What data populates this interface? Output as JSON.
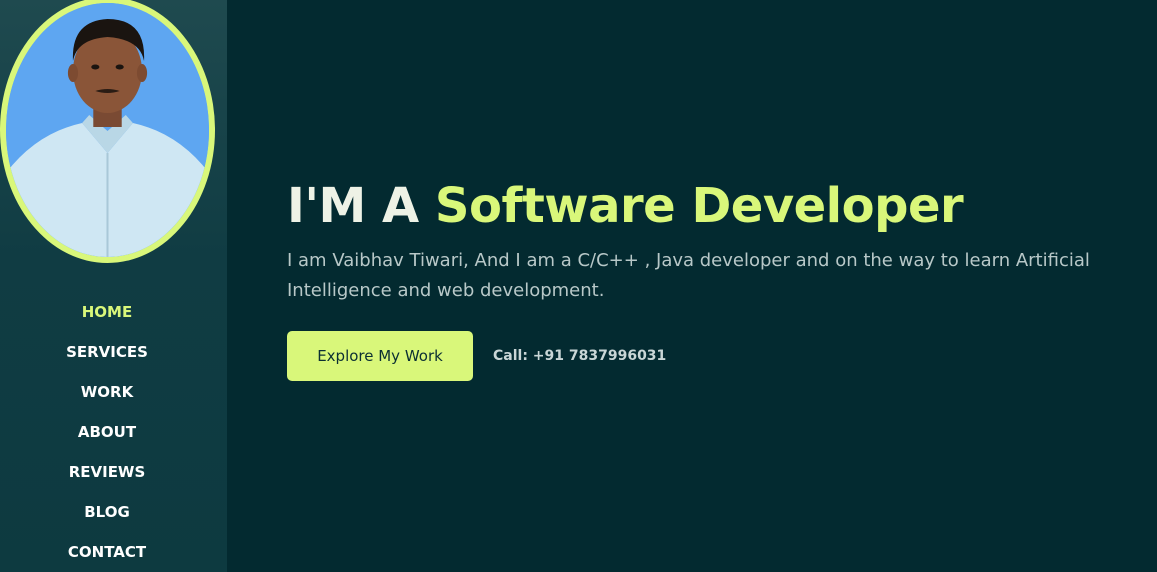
{
  "sidebar": {
    "avatar_alt": "Vaibhav Tiwari",
    "nav": [
      {
        "label": "HOME",
        "active": true
      },
      {
        "label": "SERVICES",
        "active": false
      },
      {
        "label": "WORK",
        "active": false
      },
      {
        "label": "ABOUT",
        "active": false
      },
      {
        "label": "REVIEWS",
        "active": false
      },
      {
        "label": "BLOG",
        "active": false
      },
      {
        "label": "CONTACT",
        "active": false
      }
    ]
  },
  "hero": {
    "title_prefix": "I'M A ",
    "title_highlight": "Software Developer",
    "description": "I am Vaibhav Tiwari, And I am a C/C++ , Java developer and on the way to learn Artificial Intelligence and web development.",
    "cta_label": "Explore My Work",
    "call_text": "Call: +91 7837996031"
  },
  "colors": {
    "background": "#032a30",
    "sidebar": "#0d3a40",
    "accent": "#d9f77a",
    "text": "#eef2e6"
  }
}
